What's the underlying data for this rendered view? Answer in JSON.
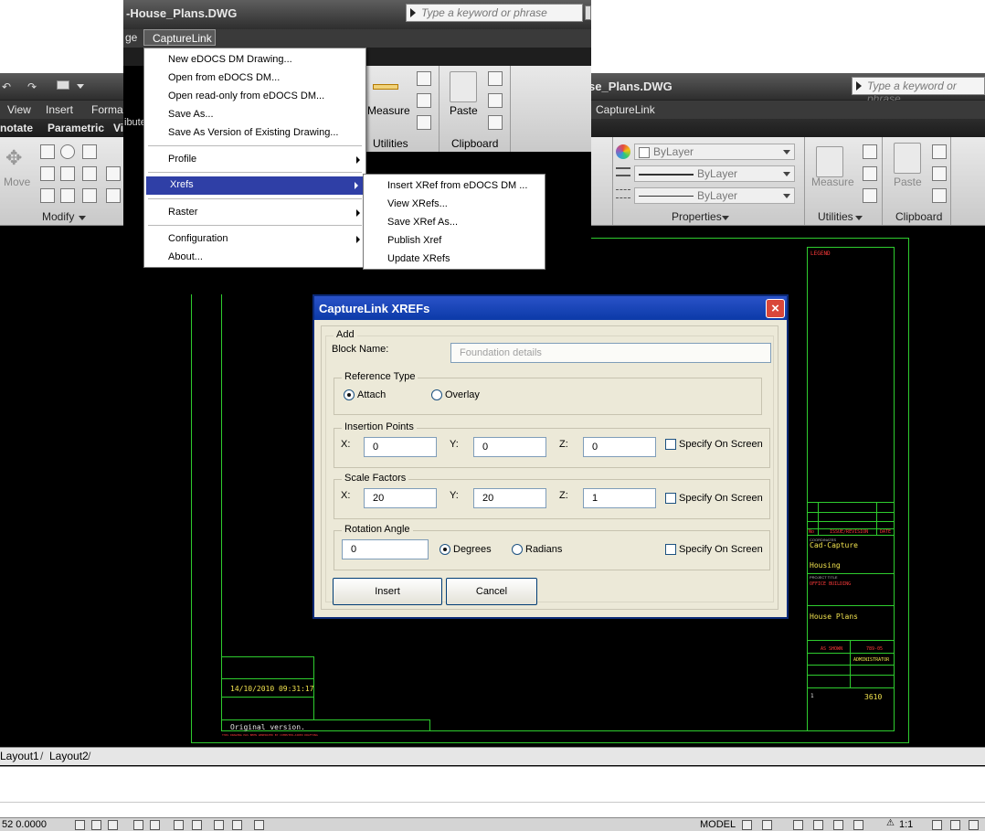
{
  "background_window": {
    "title": "se_Plans.DWG",
    "search_placeholder": "Type a keyword or phrase",
    "menu": [
      "View",
      "Insert",
      "Forma",
      "CaptureLink"
    ],
    "ribbon_tabs": [
      "notate",
      "Parametric",
      "Vi"
    ],
    "panels": {
      "modify": "Modify",
      "move": "Move",
      "measure": "Measure",
      "paste": "Paste",
      "utilities": "Utilities",
      "clipboard": "Clipboard",
      "properties": "Properties",
      "bylayer_1": "ByLayer",
      "bylayer_2": "ByLayer",
      "bylayer_3": "ByLayer"
    },
    "layout_tabs": [
      "Layout1",
      "Layout2"
    ],
    "status": {
      "coords": "52  0.0000",
      "model": "MODEL",
      "scale": "1:1"
    }
  },
  "title_block": {
    "legend": "LEGEND",
    "issue_header": [
      "No",
      "ISSUE/REVISION",
      "DATE"
    ],
    "coordinates_label": "COORDINATES",
    "company": "Cad-Capture",
    "department": "Housing",
    "project_label": "PROJECT TITLE",
    "project": "OFFICE BUILDING",
    "drawing_title": "House Plans",
    "scale": "AS SHOWN",
    "job_no": "789-05",
    "drawn_by": "ADMINISTRATOR",
    "version": "1",
    "doc_no": "3610",
    "timestamp": "14/10/2010  09:31:17",
    "original_version": "Original version.",
    "footnote": "THIS DRAWING HAS BEEN GENERATED BY COMPUTER-AIDED DRAFTING"
  },
  "top_window": {
    "title": "-House_Plans.DWG",
    "search_placeholder": "Type a keyword or phrase",
    "menu_prefix": "ge",
    "menu_capturelink": "CaptureLink",
    "measure": "Measure",
    "paste": "Paste",
    "utilities": "Utilities",
    "clipboard": "Clipboard"
  },
  "capturelink_menu": {
    "items": [
      "New eDOCS DM Drawing...",
      "Open from eDOCS DM...",
      "Open read-only from eDOCS DM...",
      "Save As...",
      "Save As Version of Existing Drawing...",
      "Profile",
      "Xrefs",
      "Raster",
      "Configuration",
      "About..."
    ]
  },
  "xrefs_submenu": {
    "items": [
      "Insert XRef from eDOCS DM ...",
      "View XRefs...",
      "Save XRef As...",
      "Publish Xref",
      "Update XRefs"
    ]
  },
  "dialog": {
    "title": "CaptureLink XREFs",
    "close": "×",
    "add_group": "Add",
    "block_name_label": "Block Name:",
    "block_name_value": "Foundation details",
    "reference_type": {
      "label": "Reference Type",
      "options": [
        "Attach",
        "Overlay"
      ],
      "selected": "Attach"
    },
    "insertion_points": {
      "label": "Insertion Points",
      "x_label": "X:",
      "x": "0",
      "y_label": "Y:",
      "y": "0",
      "z_label": "Z:",
      "z": "0",
      "specify": "Specify On Screen",
      "specify_checked": false
    },
    "scale_factors": {
      "label": "Scale Factors",
      "x_label": "X:",
      "x": "20",
      "y_label": "Y:",
      "y": "20",
      "z_label": "Z:",
      "z": "1",
      "specify": "Specify On Screen",
      "specify_checked": false
    },
    "rotation_angle": {
      "label": "Rotation Angle",
      "value": "0",
      "options": [
        "Degrees",
        "Radians"
      ],
      "selected": "Degrees",
      "specify": "Specify On Screen",
      "specify_checked": false
    },
    "insert_button": "Insert",
    "cancel_button": "Cancel"
  }
}
